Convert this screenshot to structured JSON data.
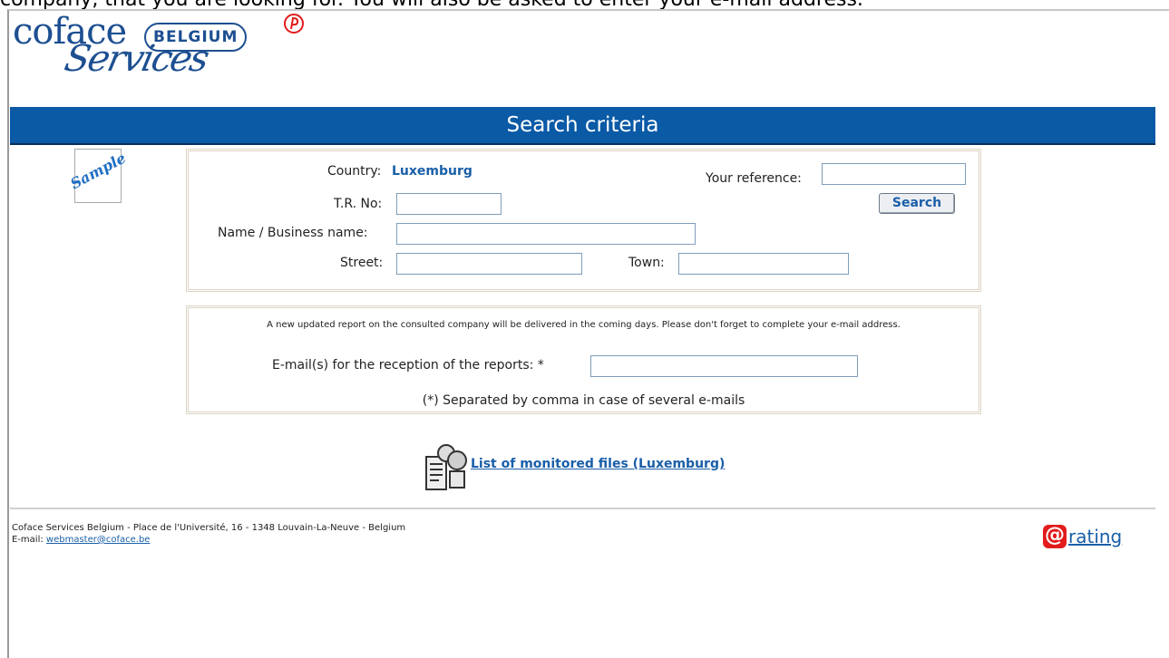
{
  "top_caption": "company, that you are looking for. You will also be asked to enter your e-mail address.",
  "logo": {
    "word1": "coface",
    "badge": "BELGIUM",
    "word2": "Services"
  },
  "banner": {
    "title": "Search criteria"
  },
  "sample": {
    "label": "Sample"
  },
  "search_form": {
    "country_label": "Country:",
    "country_value": "Luxemburg",
    "reference_label": "Your reference:",
    "reference_value": "",
    "search_button": "Search",
    "tr_label": "T.R. No:",
    "tr_value": "",
    "name_label": "Name / Business name:",
    "name_value": "",
    "street_label": "Street:",
    "street_value": "",
    "town_label": "Town:",
    "town_value": ""
  },
  "email_form": {
    "notice": "A new updated report on the consulted company will be delivered in the coming days. Please don't forget to complete your e-mail address.",
    "email_label": "E-mail(s) for the reception of the reports: *",
    "email_value": "",
    "separator_note": "(*) Separated by comma in case of several e-mails"
  },
  "monitored": {
    "link": "List of monitored files (Luxemburg)"
  },
  "footer": {
    "address": "Coface Services Belgium - Place de l'Université, 16 - 1348 Louvain-La-Neuve - Belgium",
    "email_label": "E-mail: ",
    "email_link": "webmaster@coface.be",
    "rating_at": "@",
    "rating_text": "rating"
  }
}
